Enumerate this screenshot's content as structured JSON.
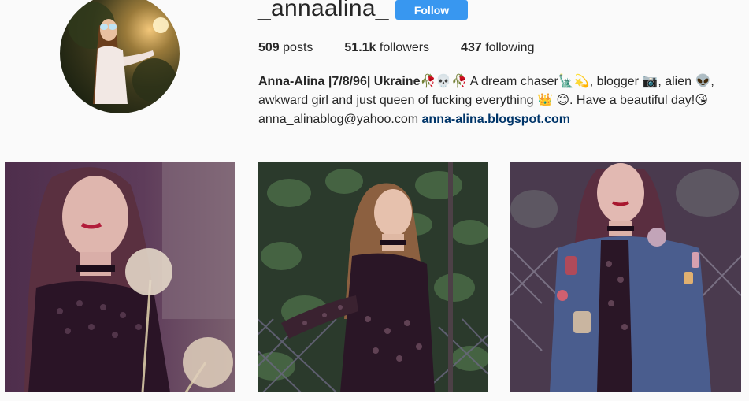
{
  "profile": {
    "username": "_annaalina_",
    "follow_label": "Follow",
    "avatar_icon": "profile-photo"
  },
  "stats": {
    "posts_count": "509",
    "posts_label": "posts",
    "followers_count": "51.1k",
    "followers_label": "followers",
    "following_count": "437",
    "following_label": "following"
  },
  "bio": {
    "name": "Anna-Alina |7/8/96| Ukraine🥀💀🥀",
    "text": " A dream chaser🗽💫, blogger 📷, alien 👽, awkward girl and just queen of fucking everything 👑 😊. Have a beautiful day!😘",
    "email": "anna_alinablog@yahoo.com",
    "link": "anna-alina.blogspot.com"
  },
  "posts": [
    {
      "label": "photo-with-dandelions"
    },
    {
      "label": "photo-by-fence"
    },
    {
      "label": "photo-denim-jacket"
    }
  ],
  "colors": {
    "follow_button": "#3897f0",
    "link": "#003569",
    "background": "#fafafa"
  }
}
